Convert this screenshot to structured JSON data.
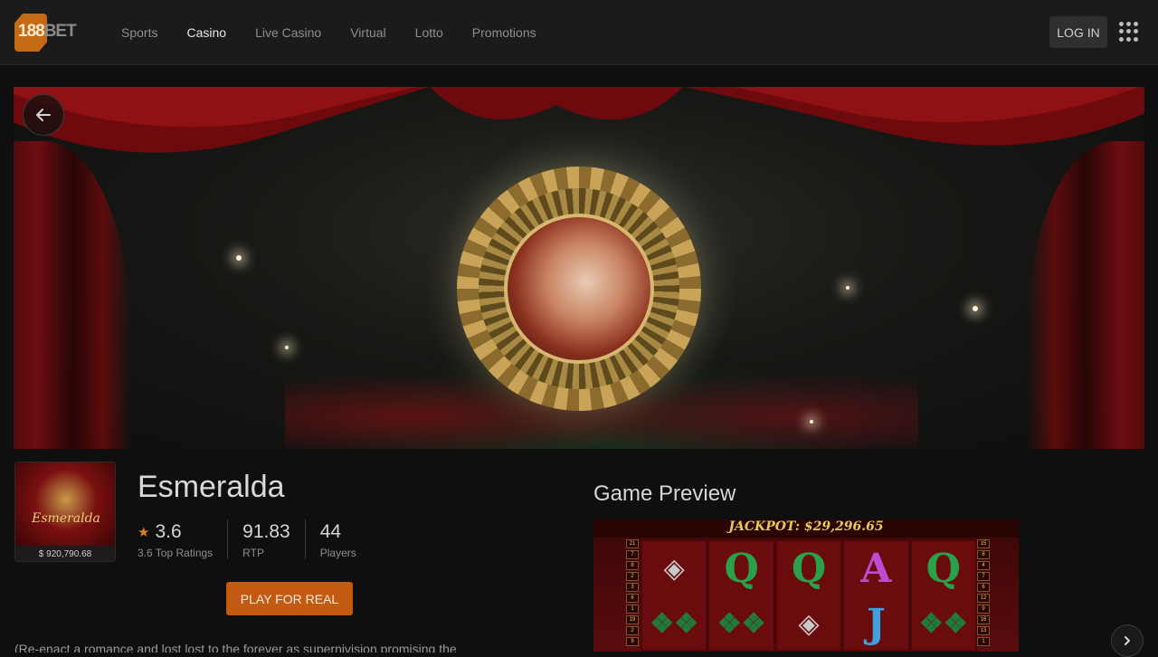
{
  "header": {
    "logo_text_num": "188",
    "logo_text_brand": "BET",
    "nav": [
      {
        "label": "Sports"
      },
      {
        "label": "Casino"
      },
      {
        "label": "Live Casino"
      },
      {
        "label": "Virtual"
      },
      {
        "label": "Lotto"
      },
      {
        "label": "Promotions"
      }
    ],
    "active_nav": "Casino",
    "login_label": "LOG IN"
  },
  "game": {
    "title": "Esmeralda",
    "thumb_title": "Esmeralda",
    "jackpot": "$ 920,790.68",
    "rating": "3.6",
    "rating_label": "3.6 Top Ratings",
    "rtp": "91.83",
    "rtp_label": "RTP",
    "players": "44",
    "players_label": "Players",
    "play_label": "PLAY FOR REAL",
    "description": "(Re-enact a romance and lost lost to the forever as supernivision promising the"
  },
  "preview": {
    "title": "Game Preview",
    "jackpot_text": "JACKPOT: $29,296.65"
  },
  "colors": {
    "accent": "#c35a12",
    "star": "#d8811c",
    "background": "#0f0f10",
    "header": "#1b1b1c"
  }
}
